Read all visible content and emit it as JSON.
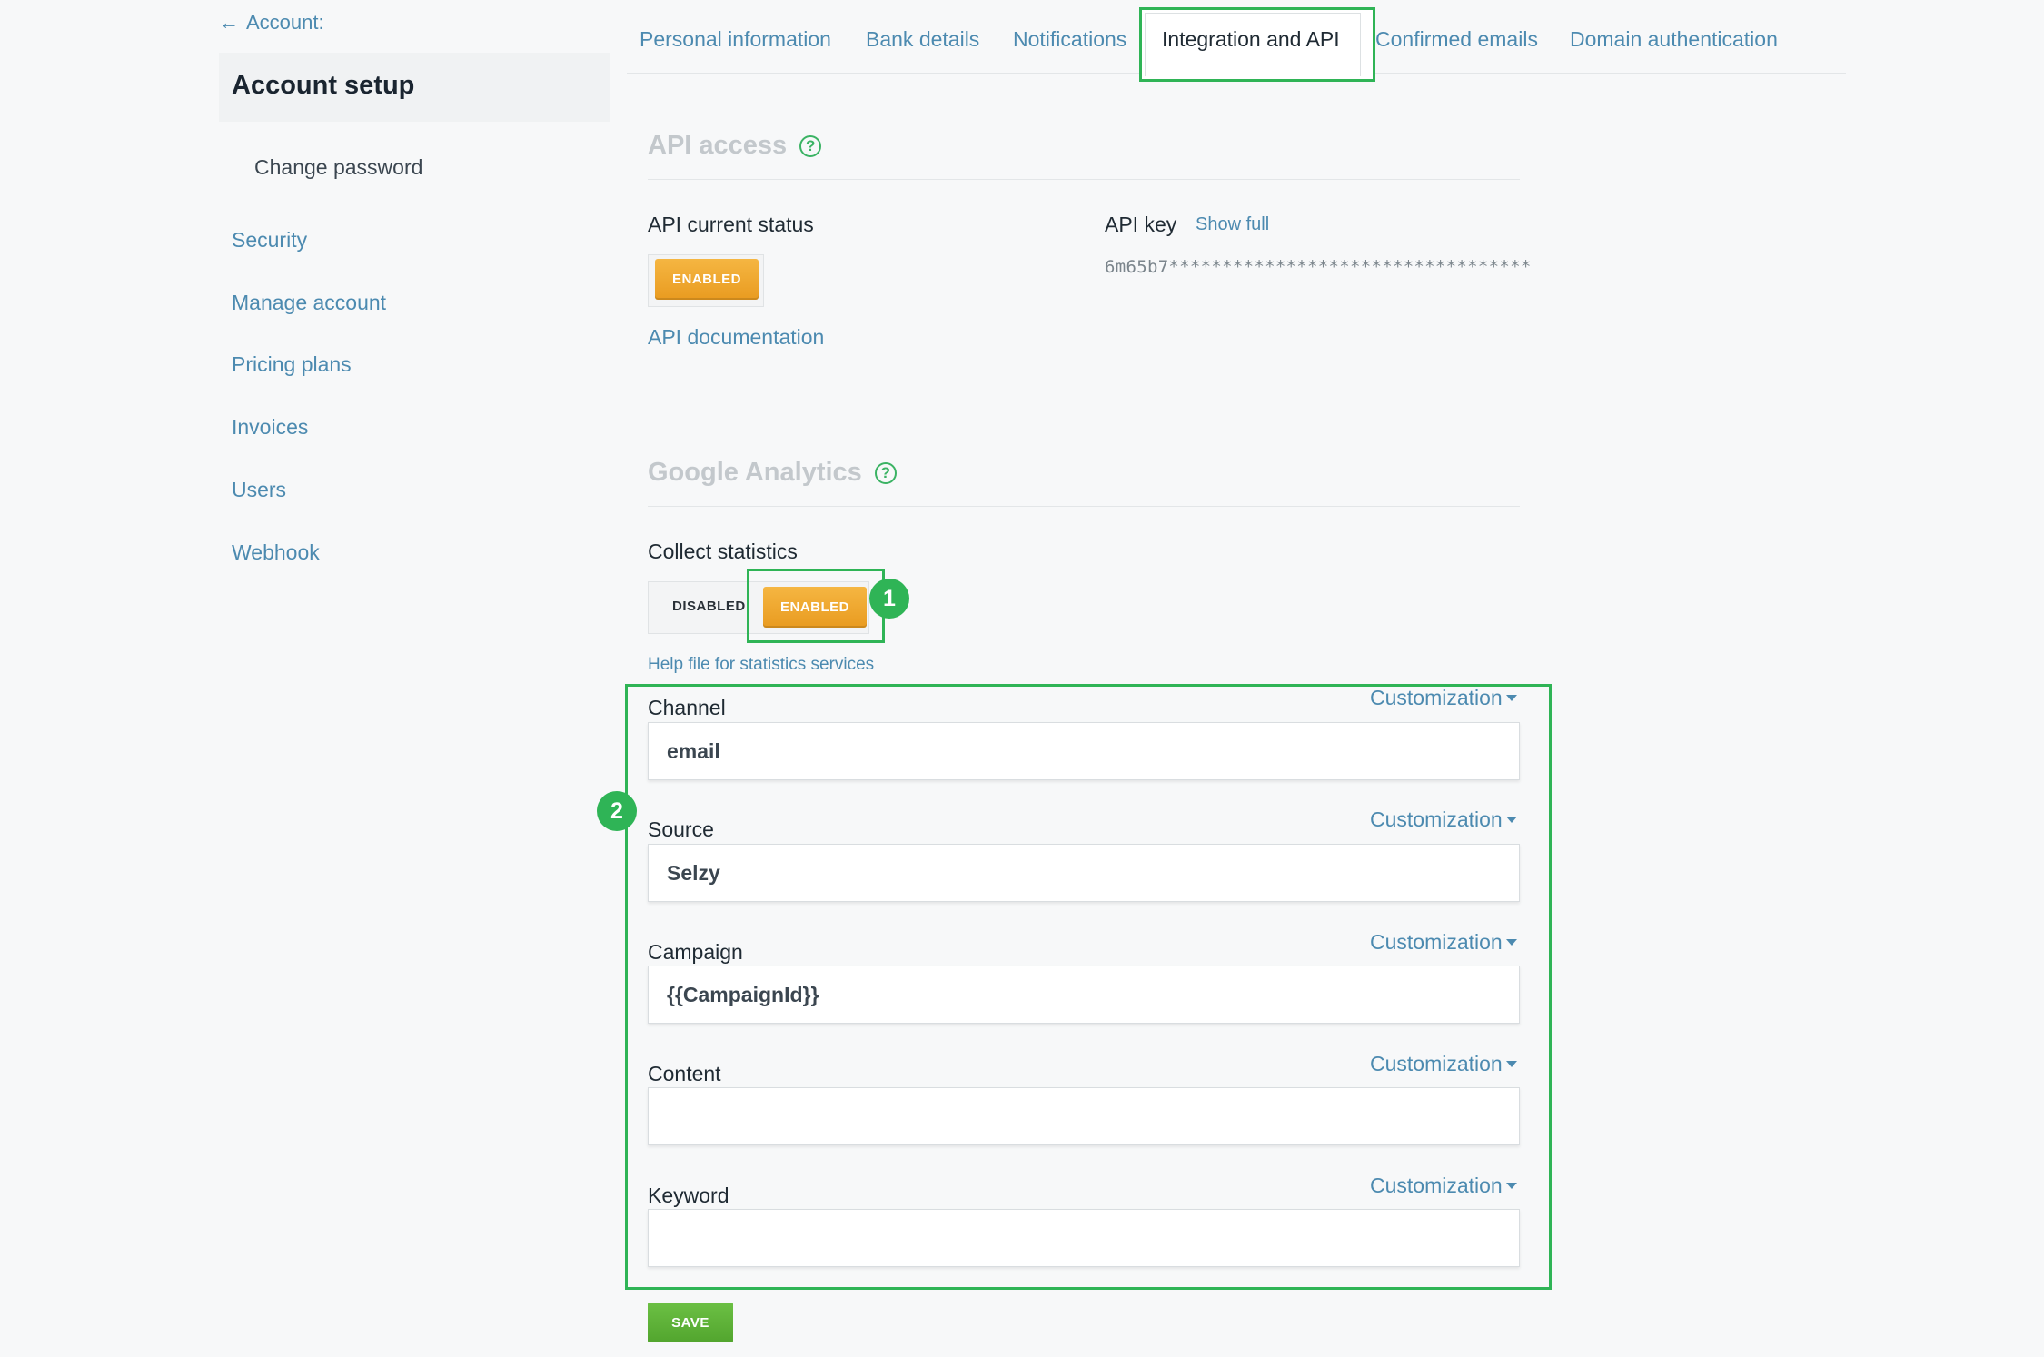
{
  "sidebar": {
    "back_label": "Account:",
    "title": "Account setup",
    "sub_item": "Change password",
    "items": [
      "Security",
      "Manage account",
      "Pricing plans",
      "Invoices",
      "Users",
      "Webhook"
    ]
  },
  "tabs": [
    "Personal information",
    "Bank details",
    "Notifications",
    "Integration and API",
    "Confirmed emails",
    "Domain authentication"
  ],
  "active_tab": "Integration and API",
  "api": {
    "section_title": "API access",
    "status_label": "API current status",
    "status_button": "ENABLED",
    "doc_link": "API documentation",
    "key_label": "API key",
    "show_full": "Show full",
    "key_value": "6m65b7**********************************"
  },
  "ga": {
    "section_title": "Google Analytics",
    "collect_label": "Collect statistics",
    "disabled": "DISABLED",
    "enabled": "ENABLED",
    "help_link": "Help file for statistics services",
    "customization": "Customization",
    "fields": [
      {
        "label": "Channel",
        "value": "email"
      },
      {
        "label": "Source",
        "value": "Selzy"
      },
      {
        "label": "Campaign",
        "value": "{{CampaignId}}"
      },
      {
        "label": "Content",
        "value": ""
      },
      {
        "label": "Keyword",
        "value": ""
      }
    ],
    "save": "SAVE"
  },
  "badges": [
    "1",
    "2"
  ],
  "colors": {
    "accent_green": "#2fb456",
    "enabled_orange": "#f0a830",
    "link_blue": "#4c8ab0"
  }
}
